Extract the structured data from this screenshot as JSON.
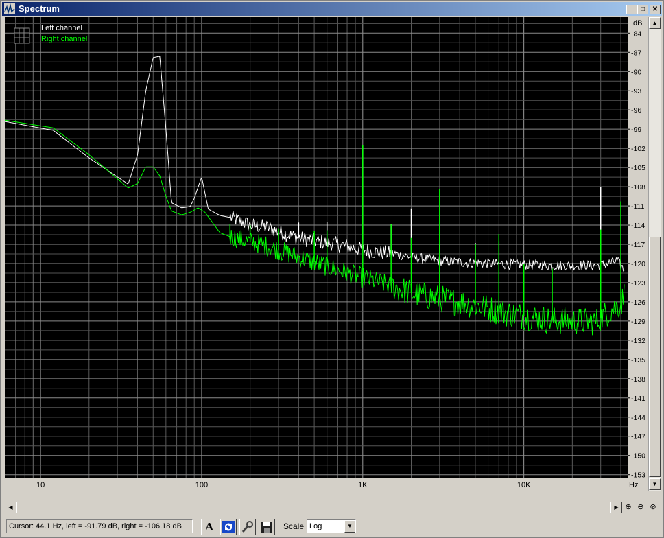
{
  "window": {
    "title": "Spectrum",
    "minimize_glyph": "_",
    "maximize_glyph": "□",
    "close_glyph": "✕"
  },
  "chart_data": {
    "type": "line",
    "title": "",
    "xlabel": "Hz",
    "ylabel": "dB",
    "x_scale": "log",
    "xlim": [
      6,
      44100
    ],
    "ylim": [
      -155.5,
      -81.5
    ],
    "x_ticks": [
      10,
      100,
      1000,
      10000
    ],
    "x_tick_labels": [
      "10",
      "100",
      "1K",
      "10K"
    ],
    "y_ticks": [
      -84,
      -87,
      -90,
      -93,
      -96,
      -99,
      -102,
      -105,
      -108,
      -111,
      -114,
      -117,
      -120,
      -123,
      -126,
      -129,
      -132,
      -135,
      -138,
      -141,
      -144,
      -147,
      -150,
      -153
    ],
    "grid": true,
    "legend_position": "top-left",
    "series": [
      {
        "name": "Left channel",
        "color": "#ffffff",
        "points": [
          [
            6,
            -97.8
          ],
          [
            12,
            -99.2
          ],
          [
            20,
            -103.5
          ],
          [
            35,
            -107.6
          ],
          [
            40,
            -103
          ],
          [
            45,
            -93
          ],
          [
            50,
            -87.8
          ],
          [
            55,
            -87.6
          ],
          [
            60,
            -99
          ],
          [
            65,
            -110.5
          ],
          [
            75,
            -111.3
          ],
          [
            85,
            -111.1
          ],
          [
            90,
            -109.8
          ],
          [
            100,
            -106.5
          ],
          [
            110,
            -111.5
          ],
          [
            130,
            -112.5
          ],
          [
            150,
            -112.8
          ],
          [
            180,
            -113.5
          ],
          [
            200,
            -114
          ],
          [
            250,
            -114.3
          ],
          [
            300,
            -115
          ],
          [
            400,
            -116
          ],
          [
            500,
            -116.5
          ],
          [
            700,
            -117
          ],
          [
            900,
            -117.6
          ],
          [
            1200,
            -118.2
          ],
          [
            1600,
            -118.5
          ],
          [
            2000,
            -119
          ],
          [
            3000,
            -119.6
          ],
          [
            5000,
            -119.9
          ],
          [
            8000,
            -120.1
          ],
          [
            15000,
            -120.3
          ],
          [
            30000,
            -120.3
          ],
          [
            38000,
            -119.6
          ],
          [
            42000,
            -121
          ]
        ],
        "peaks": [
          [
            400,
            -113.6
          ],
          [
            600,
            -113.5
          ],
          [
            1000,
            -101.5
          ],
          [
            1500,
            -113.8
          ],
          [
            2000,
            -111.4
          ],
          [
            3000,
            -117
          ],
          [
            5000,
            -116.8
          ],
          [
            7000,
            -116.5
          ],
          [
            30000,
            -108
          ]
        ]
      },
      {
        "name": "Right channel",
        "color": "#00ff00",
        "points": [
          [
            6,
            -97.6
          ],
          [
            12,
            -98.8
          ],
          [
            20,
            -103
          ],
          [
            35,
            -108.2
          ],
          [
            40,
            -107.5
          ],
          [
            45,
            -104.9
          ],
          [
            50,
            -104.9
          ],
          [
            55,
            -106.3
          ],
          [
            60,
            -109.5
          ],
          [
            65,
            -111.8
          ],
          [
            75,
            -112.4
          ],
          [
            85,
            -112
          ],
          [
            95,
            -111.3
          ],
          [
            105,
            -112
          ],
          [
            130,
            -115.2
          ],
          [
            150,
            -115.8
          ],
          [
            180,
            -116.3
          ],
          [
            250,
            -117.2
          ],
          [
            350,
            -118.5
          ],
          [
            500,
            -119.8
          ],
          [
            700,
            -121
          ],
          [
            1000,
            -122.2
          ],
          [
            1500,
            -123.5
          ],
          [
            2000,
            -124.6
          ],
          [
            3000,
            -125.5
          ],
          [
            5000,
            -126.5
          ],
          [
            8000,
            -127.8
          ],
          [
            15000,
            -128.9
          ],
          [
            28000,
            -129.1
          ],
          [
            35000,
            -127.2
          ],
          [
            40000,
            -126.4
          ],
          [
            42000,
            -124.8
          ]
        ],
        "peaks": [
          [
            150,
            -113.8
          ],
          [
            200,
            -114
          ],
          [
            300,
            -114.5
          ],
          [
            500,
            -114.9
          ],
          [
            600,
            -114.8
          ],
          [
            1000,
            -101.5
          ],
          [
            1500,
            -113.9
          ],
          [
            2000,
            -116
          ],
          [
            3000,
            -108.4
          ],
          [
            5000,
            -117
          ],
          [
            7000,
            -115.4
          ],
          [
            10000,
            -120
          ],
          [
            15000,
            -120.8
          ],
          [
            30000,
            -114.7
          ],
          [
            40000,
            -110.3
          ]
        ]
      }
    ]
  },
  "status": {
    "cursor_text": "Cursor:  44.1 Hz,  left = -91.79 dB,  right = -106.18 dB"
  },
  "toolbar": {
    "font_button_label": "A",
    "scale_label": "Scale",
    "scale_value": "Log"
  },
  "zoom": {
    "in_glyph": "⊕",
    "out_glyph": "⊖",
    "fit_glyph": "⊘"
  }
}
